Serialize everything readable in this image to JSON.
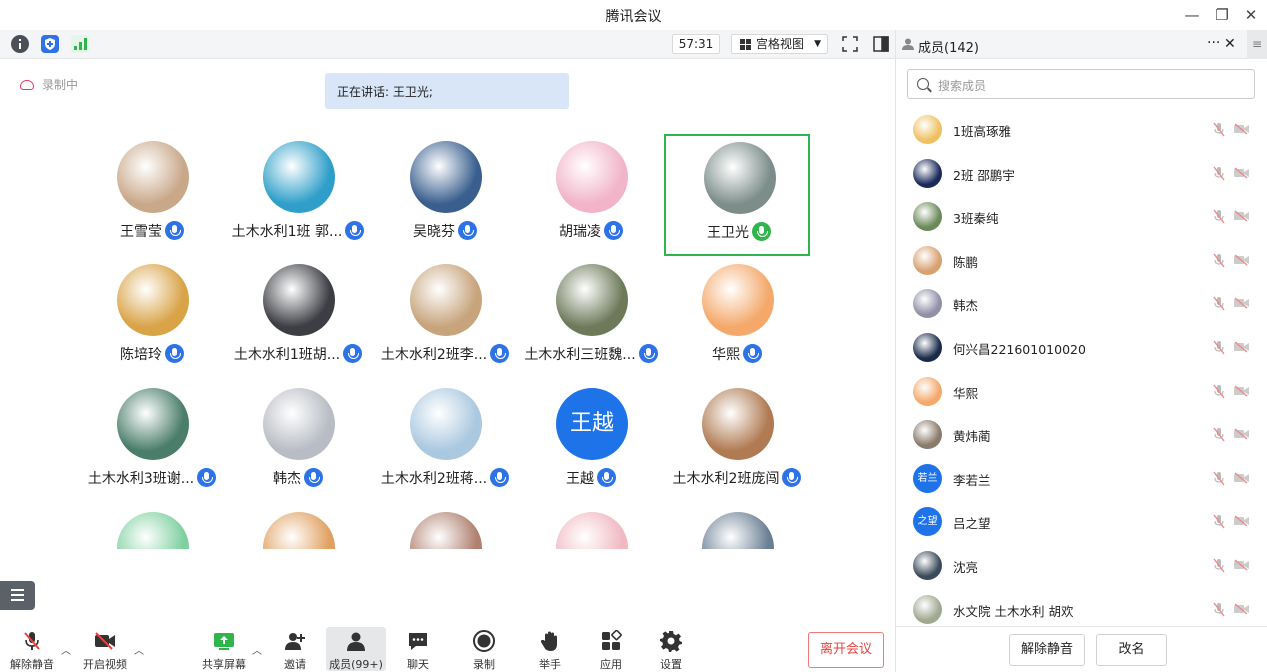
{
  "window": {
    "title": "腾讯会议"
  },
  "toolbar": {
    "timer": "57:31",
    "view_label": "宫格视图"
  },
  "main": {
    "recording_label": "录制中",
    "speaking": "正在讲话: 王卫光;",
    "tiles": [
      {
        "name": "王雪莹",
        "color": "#c9a88a",
        "mic": "blue"
      },
      {
        "name": "土木水利1班 郭...",
        "color": "#2f9fc9",
        "mic": "blue"
      },
      {
        "name": "吴晓芬",
        "color": "#3a5f8f",
        "mic": "blue"
      },
      {
        "name": "胡瑞凌",
        "color": "#f2b4c8",
        "mic": "blue"
      },
      {
        "name": "王卫光",
        "color": "#7c8d8a",
        "mic": "green",
        "active": true
      },
      {
        "name": "陈培玲",
        "color": "#d9a347",
        "mic": "blue"
      },
      {
        "name": "土木水利1班胡...",
        "color": "#3c3e44",
        "mic": "blue"
      },
      {
        "name": "土木水利2班李...",
        "color": "#c7a47c",
        "mic": "blue"
      },
      {
        "name": "土木水利三班魏...",
        "color": "#6d7a5a",
        "mic": "blue"
      },
      {
        "name": "华熙",
        "color": "#f4a86a",
        "mic": "blue"
      },
      {
        "name": "土木水利3班谢...",
        "color": "#4a7d6a",
        "mic": "blue"
      },
      {
        "name": "韩杰",
        "color": "#b8bcc4",
        "mic": "blue"
      },
      {
        "name": "土木水利2班蒋...",
        "color": "#aac8e0",
        "mic": "blue"
      },
      {
        "name": "王越",
        "color": "#1e73e8",
        "mic": "blue",
        "text": "王越"
      },
      {
        "name": "土木水利2班庞闯",
        "color": "#b07a52",
        "mic": "blue"
      },
      {
        "name": "",
        "color": "#7fd0a0"
      },
      {
        "name": "",
        "color": "#e0a060"
      },
      {
        "name": "",
        "color": "#b08070"
      },
      {
        "name": "",
        "color": "#f0b8c0"
      },
      {
        "name": "",
        "color": "#6a7f94"
      }
    ]
  },
  "bottombar": {
    "unmute": "解除静音",
    "video": "开启视频",
    "share": "共享屏幕",
    "invite": "邀请",
    "members": "成员(99+)",
    "chat": "聊天",
    "record": "录制",
    "raise": "举手",
    "apps": "应用",
    "settings": "设置",
    "leave": "离开会议"
  },
  "panel": {
    "title": "成员(142)",
    "search_placeholder": "搜索成员",
    "members": [
      {
        "name": "1班高琢雅",
        "color": "#f0c060"
      },
      {
        "name": "2班   邵鹏宇",
        "color": "#1a2a5a"
      },
      {
        "name": "3班秦纯",
        "color": "#6a8a5a"
      },
      {
        "name": "陈鹏",
        "color": "#d9a070"
      },
      {
        "name": "韩杰",
        "color": "#9090a8"
      },
      {
        "name": "何兴昌221601010020",
        "color": "#1a2a4a"
      },
      {
        "name": "华熙",
        "color": "#f4a86a"
      },
      {
        "name": "黄炜蔺",
        "color": "#8a7a6a"
      },
      {
        "name": "李若兰",
        "color": "#1e73e8",
        "text": "若兰"
      },
      {
        "name": "吕之望",
        "color": "#1e73e8",
        "text": "之望"
      },
      {
        "name": "沈亮",
        "color": "#3a4a5a"
      },
      {
        "name": "水文院 土木水利 胡欢",
        "color": "#a0a890"
      }
    ],
    "unmute_all": "解除静音",
    "rename": "改名"
  }
}
